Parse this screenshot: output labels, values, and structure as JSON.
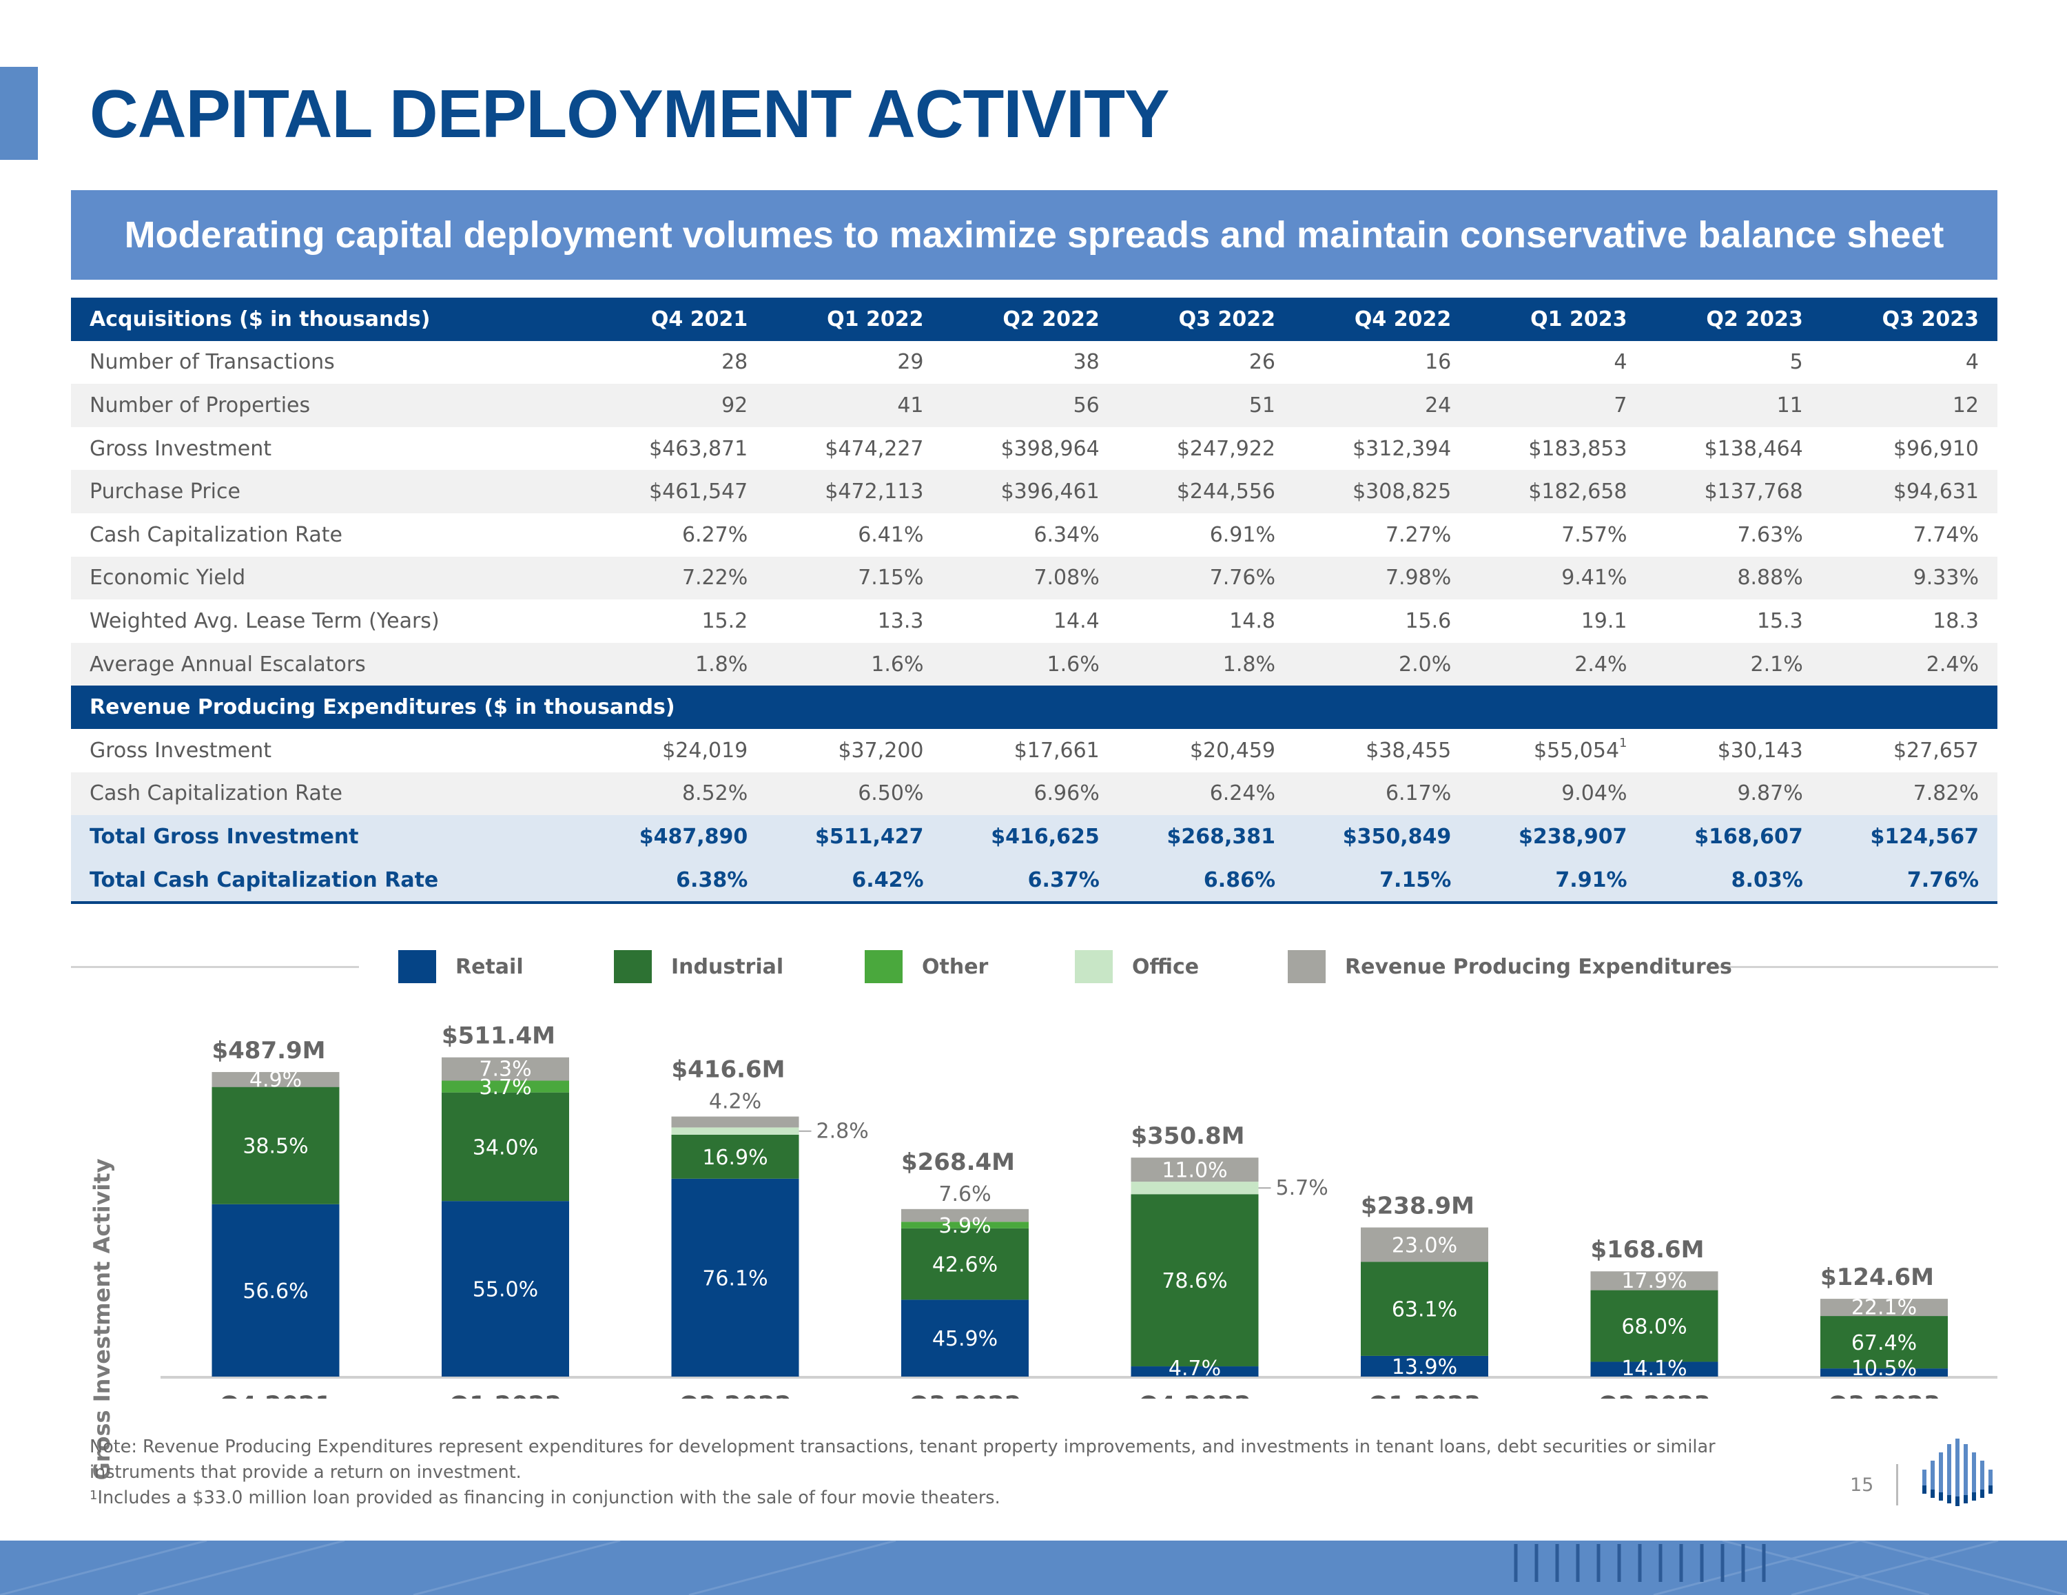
{
  "page": {
    "title": "CAPITAL DEPLOYMENT ACTIVITY",
    "subtitle": "Moderating capital deployment volumes to maximize spreads and maintain conservative balance sheet",
    "page_number": "15"
  },
  "table": {
    "header": [
      "Acquisitions ($ in thousands)",
      "Q4 2021",
      "Q1 2022",
      "Q2 2022",
      "Q3 2022",
      "Q4 2022",
      "Q1 2023",
      "Q2 2023",
      "Q3 2023"
    ],
    "rows": [
      [
        "Number of Transactions",
        "28",
        "29",
        "38",
        "26",
        "16",
        "4",
        "5",
        "4"
      ],
      [
        "Number of Properties",
        "92",
        "41",
        "56",
        "51",
        "24",
        "7",
        "11",
        "12"
      ],
      [
        "Gross Investment",
        "$463,871",
        "$474,227",
        "$398,964",
        "$247,922",
        "$312,394",
        "$183,853",
        "$138,464",
        "$96,910"
      ],
      [
        "Purchase Price",
        "$461,547",
        "$472,113",
        "$396,461",
        "$244,556",
        "$308,825",
        "$182,658",
        "$137,768",
        "$94,631"
      ],
      [
        "Cash Capitalization Rate",
        "6.27%",
        "6.41%",
        "6.34%",
        "6.91%",
        "7.27%",
        "7.57%",
        "7.63%",
        "7.74%"
      ],
      [
        "Economic Yield",
        "7.22%",
        "7.15%",
        "7.08%",
        "7.76%",
        "7.98%",
        "9.41%",
        "8.88%",
        "9.33%"
      ],
      [
        "Weighted Avg. Lease Term (Years)",
        "15.2",
        "13.3",
        "14.4",
        "14.8",
        "15.6",
        "19.1",
        "15.3",
        "18.3"
      ],
      [
        "Average Annual Escalators",
        "1.8%",
        "1.6%",
        "1.6%",
        "1.8%",
        "2.0%",
        "2.4%",
        "2.1%",
        "2.4%"
      ]
    ],
    "section_header": "Revenue Producing Expenditures ($ in thousands)",
    "rpe_rows": [
      [
        "Gross Investment",
        "$24,019",
        "$37,200",
        "$17,661",
        "$20,459",
        "$38,455",
        "$55,054",
        "$30,143",
        "$27,657"
      ],
      [
        "Cash Capitalization Rate",
        "8.52%",
        "6.50%",
        "6.96%",
        "6.24%",
        "6.17%",
        "9.04%",
        "9.87%",
        "7.82%"
      ]
    ],
    "rpe_footnote_marker": "1",
    "totals": [
      [
        "Total Gross Investment",
        "$487,890",
        "$511,427",
        "$416,625",
        "$268,381",
        "$350,849",
        "$238,907",
        "$168,607",
        "$124,567"
      ],
      [
        "Total Cash Capitalization Rate",
        "6.38%",
        "6.42%",
        "6.37%",
        "6.86%",
        "7.15%",
        "7.91%",
        "8.03%",
        "7.76%"
      ]
    ]
  },
  "chart_data": {
    "type": "bar",
    "stacked": true,
    "ylabel": "Gross Investment Activity",
    "categories": [
      "Q4 2021",
      "Q1 2022",
      "Q2 2022",
      "Q3 2022",
      "Q4 2022",
      "Q1 2023",
      "Q2 2023",
      "Q3 2023"
    ],
    "totals": [
      487.9,
      511.4,
      416.6,
      268.4,
      350.8,
      238.9,
      168.6,
      124.6
    ],
    "total_labels": [
      "$487.9M",
      "$511.4M",
      "$416.6M",
      "$268.4M",
      "$350.8M",
      "$238.9M",
      "$168.6M",
      "$124.6M"
    ],
    "series": [
      {
        "name": "Retail",
        "color": "#054486",
        "values": [
          56.6,
          55.0,
          76.1,
          45.9,
          4.7,
          13.9,
          14.1,
          10.5
        ],
        "labels": [
          "56.6%",
          "55.0%",
          "76.1%",
          "45.9%",
          "4.7%",
          "13.9%",
          "14.1%",
          "10.5%"
        ]
      },
      {
        "name": "Industrial",
        "color": "#2d7233",
        "values": [
          38.5,
          34.0,
          16.9,
          42.6,
          78.6,
          63.1,
          68.0,
          67.4
        ],
        "labels": [
          "38.5%",
          "34.0%",
          "16.9%",
          "42.6%",
          "78.6%",
          "63.1%",
          "68.0%",
          "67.4%"
        ]
      },
      {
        "name": "Other",
        "color": "#4aa83d",
        "values": [
          0,
          3.7,
          0,
          3.9,
          0,
          0,
          0,
          0
        ],
        "labels": [
          "",
          "3.7%",
          "",
          "3.9%",
          "",
          "",
          "",
          ""
        ]
      },
      {
        "name": "Office",
        "color": "#c8e6c6",
        "values": [
          0,
          0,
          2.8,
          0,
          5.7,
          0,
          0,
          0
        ],
        "labels": [
          "",
          "",
          "2.8%",
          "",
          "5.7%",
          "",
          "",
          ""
        ]
      },
      {
        "name": "Revenue Producing Expenditures",
        "color": "#a5a5a0",
        "values": [
          4.9,
          7.3,
          4.2,
          7.6,
          11.0,
          23.0,
          17.9,
          22.1
        ],
        "labels": [
          "4.9%",
          "7.3%",
          "4.2%",
          "7.6%",
          "11.0%",
          "23.0%",
          "17.9%",
          "22.1%"
        ]
      }
    ],
    "ylim": [
      0,
      520
    ],
    "legend_position": "top"
  },
  "notes": {
    "line1": "Note: Revenue Producing Expenditures represent expenditures for development transactions, tenant property improvements, and investments in tenant loans, debt securities or similar instruments that provide a return on investment.",
    "line2_marker": "1",
    "line2": "Includes a $33.0 million loan provided as financing in conjunction with the sale of four movie theaters."
  }
}
